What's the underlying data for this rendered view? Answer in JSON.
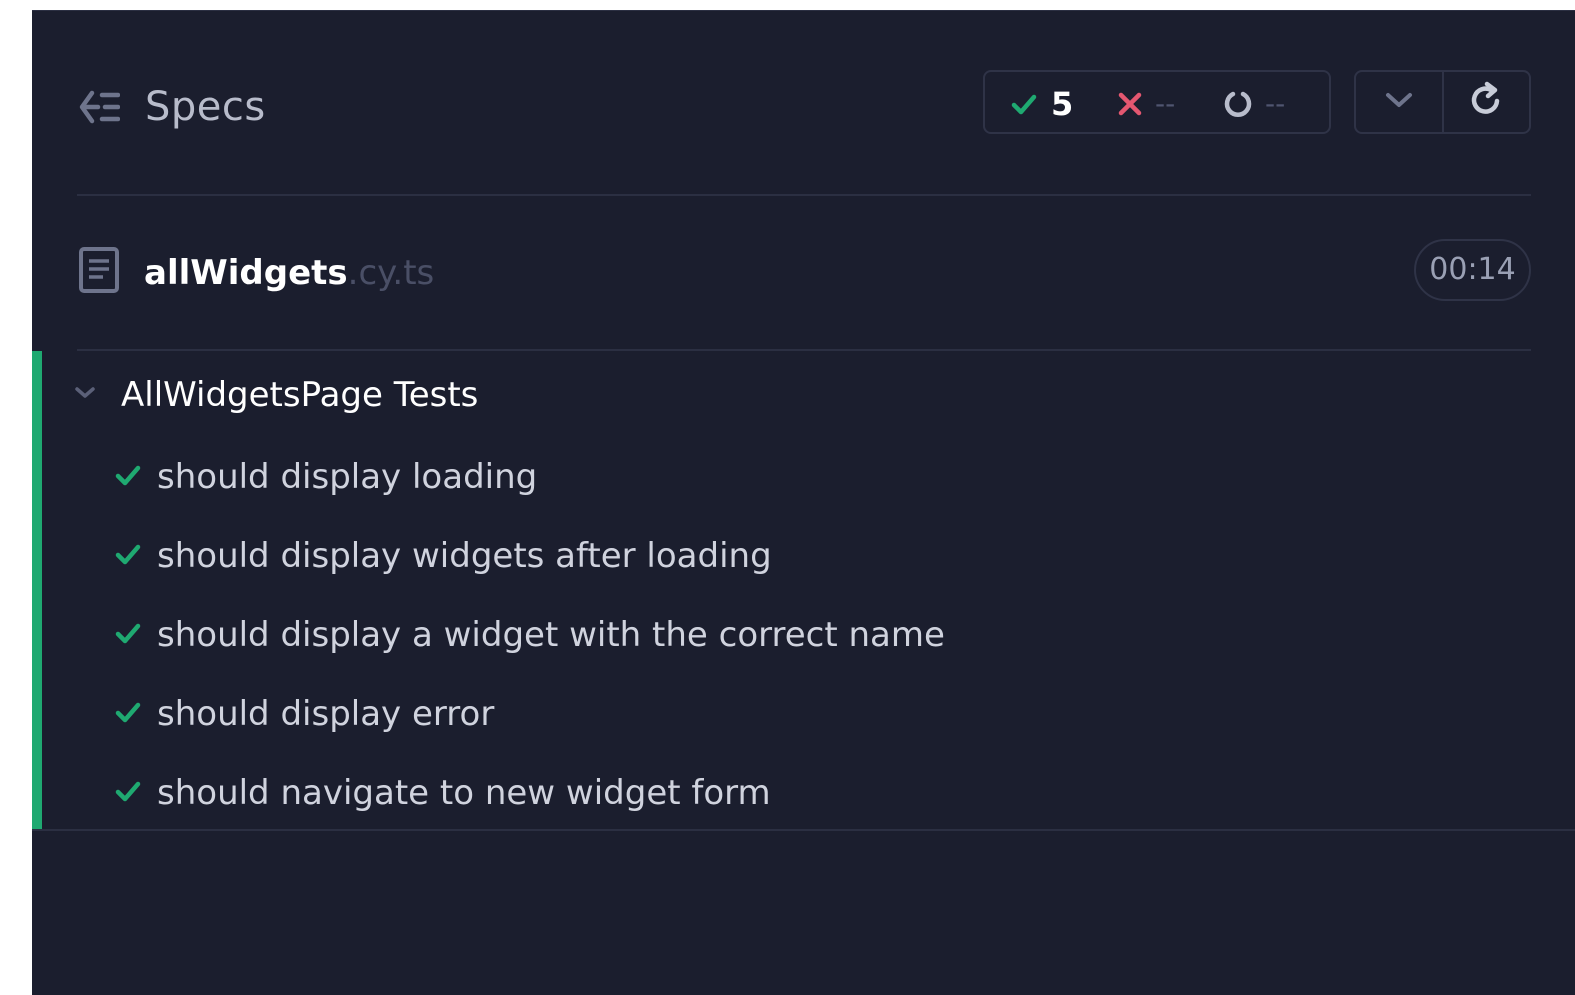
{
  "header": {
    "title": "Specs",
    "stats": {
      "passed": "5",
      "failed": "--",
      "pending": "--"
    },
    "icons": {
      "back": "back-arrow-icon",
      "pass": "check-icon",
      "fail": "x-icon",
      "pending": "pending-circle-icon",
      "collapse": "chevron-down-icon",
      "rerun": "refresh-icon"
    }
  },
  "spec": {
    "file_base": "allWidgets",
    "file_ext": ".cy.ts",
    "duration": "00:14",
    "icon": "document-icon"
  },
  "suite": {
    "title": "AllWidgetsPage Tests",
    "status": "passed",
    "tests": [
      {
        "title": "should display loading",
        "status": "passed"
      },
      {
        "title": "should display widgets after loading",
        "status": "passed"
      },
      {
        "title": "should display a widget with the correct name",
        "status": "passed"
      },
      {
        "title": "should display error",
        "status": "passed"
      },
      {
        "title": "should navigate to new widget form",
        "status": "passed"
      }
    ]
  },
  "colors": {
    "background": "#1b1e2e",
    "pass": "#1fa971",
    "fail": "#e45770",
    "muted": "#505570",
    "border": "#2f3347"
  }
}
